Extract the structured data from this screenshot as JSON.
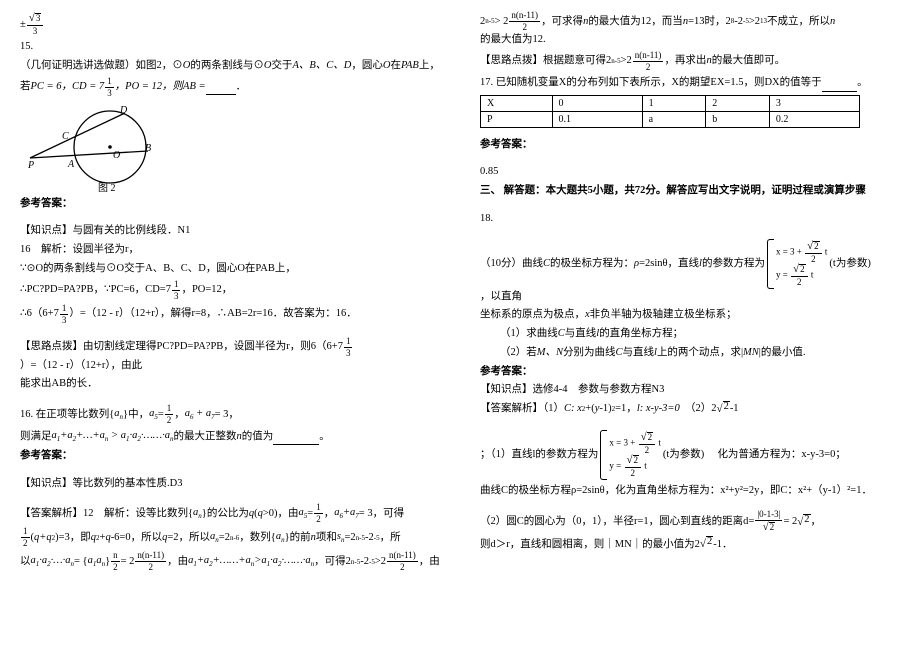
{
  "left": {
    "q15_num": "15.",
    "q15_text": "（几何证明选讲选做题）如图2，⊙",
    "q15_O": "O",
    "q15_text2": "的两条割线与⊙",
    "q15_text3": "交于",
    "pts_abcd": "A、B、C、D",
    "q15_text4": "，圆心",
    "q15_text5": "在",
    "q15_PAB": "PAB",
    "q15_text6": "上，",
    "q15_if": "若",
    "q15_pc": "PC = 6，",
    "q15_cd": "CD = 7",
    "q15_po": "，PO = 12，则",
    "q15_ab": "AB = ",
    "fig2": "图 2",
    "ans_label": "参考答案：",
    "kplabel": "【知识点】与圆有关的比例线段．N1",
    "sol16a": "16　解析：设圆半径为r，",
    "sol16b": "∵⊙O的两条割线与⊙O交于A、B、C、D，圆心O在PAB上，",
    "sol16c": "∴PC?PD=PA?PB，∵PC=6，CD=7",
    "sol16c2": "，PO=12，",
    "sol16d": "∴6（6+",
    "sol16d2": "）=（12 - r）（12+r），解得r=8，∴AB=2r=16．故答案为：16．",
    "think1": "【思路点拨】由切割线定理得PC?PD=PA?PB，设圆半径为r，则6（6+",
    "think1b": "）=（12 - r）（12+r），由此",
    "think1c": "能求出AB的长．",
    "q16": "16. 在正项等比数列",
    "q16_mid": "中，",
    "q16_tail": "，",
    "q16_line2a": "则满足",
    "q16_line2b": "的最大正整数",
    "q16_line2c": "的值为",
    "kp2": "【知识点】等比数列的基本性质.D3",
    "ans_parse": "【答案解析】",
    "ap_12": "12",
    "ap_text1": "　解析：设等比数列",
    "ap_text1b": "的公比为",
    "ap_text1c": "，由",
    "ap_text1d": "，",
    "ap_text2": "，即",
    "ap_text2b": "，所以",
    "ap_text2c": "，所以",
    "ap_text2d": "，数列",
    "ap_text2e": "的前",
    "ap_text2f": "项和",
    "ap_text2g": "，所",
    "ap_text3": "以",
    "ap_text3b": "，由",
    "ap_text3c": "，可得",
    "ap_text3d": "，由"
  },
  "right": {
    "line1a": "，可求得",
    "line1b": "的最大值为12，而当",
    "line1c": "时，",
    "line1d": "不成立，所以",
    "line1e": "的最大值为12.",
    "think2a": "【思路点拨】根据题意可得",
    "think2b": "，再求出",
    "think2c": "的最大值即可。",
    "q17a": "17. 已知随机变量X的分布列如下表所示，X的期望EX=1.5，则DX的值等于",
    "tblX": "X",
    "tblP": "P",
    "t0": "0",
    "t1": "1",
    "t2": "2",
    "t3": "3",
    "p0": "0.1",
    "pa": "a",
    "pb": "b",
    "p3": "0.2",
    "ans2": "0.85",
    "sec3": "三、 解答题：本大题共5小题，共72分。解答应写出文字说明，证明过程或演算步骤",
    "q18": "18.",
    "q18_a": "（10分）曲线",
    "q18_a2": "的极坐标方程为：",
    "q18_a3": "，直线",
    "q18_a4": "的参数方程为",
    "q18_a5": "，以直角",
    "q18_b": "坐标系的原点为极点，",
    "q18_b2": "非负半轴为极轴建立极坐标系；",
    "q18_1": "（1）求曲线",
    "q18_1b": "的直角坐标方程；",
    "q18_2": "（2）若",
    "q18_2b": "分别为曲线",
    "q18_2c": "上的两个动点，求",
    "q18_2d": "的最小值.",
    "kp3": "【知识点】选修4-4　参数与参数方程N3",
    "ap3a": "【答案解析】（1）",
    "ap3b": "　（2）",
    "sol_intro": "；（1）直线l的参数方程为",
    "sol_intro2": "化为普通方程为：x-y-3=0；",
    "sol_c1": "曲线C的极坐标方程ρ=2sinθ，化为直角坐标方程为：x²+y²=2y，即C：x²+（y-1）²=1．",
    "sol_2a": "（2）圆C的圆心为（0，1），半径r=1，圆心到直线的距离d=",
    "sol_2b": "，",
    "sol_2c": "则d＞r，直线和圆相离，则｜MN｜的最小值为2",
    "sol_2d": "-1．"
  }
}
